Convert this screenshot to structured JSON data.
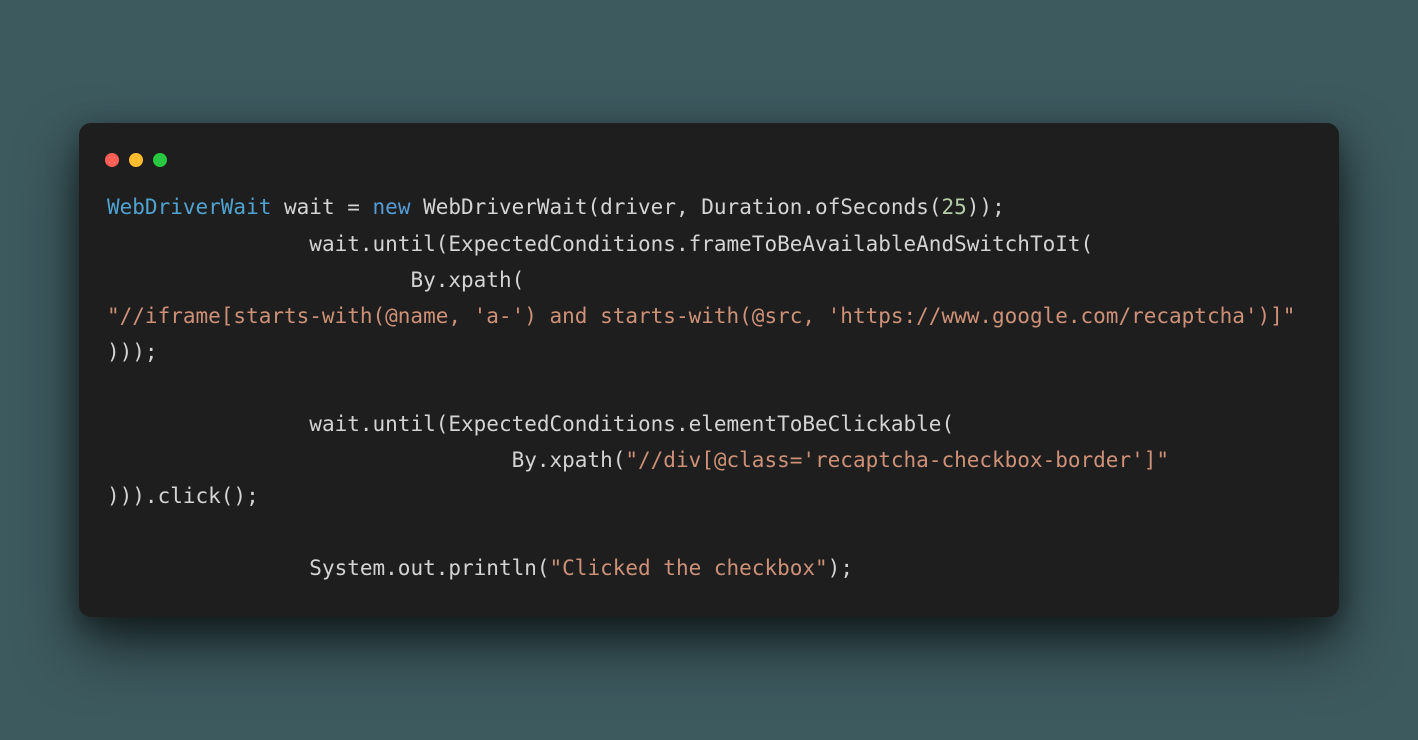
{
  "code": {
    "l1_type": "WebDriverWait",
    "l1_between": " wait = ",
    "l1_new": "new",
    "l1_rest": " WebDriverWait(driver, Duration.ofSeconds(",
    "l1_num": "25",
    "l1_close": "));",
    "l2_indent": "                ",
    "l2_rest": "wait.until(ExpectedConditions.frameToBeAvailableAndSwitchToIt(",
    "l3_indent": "                        ",
    "l3_rest": "By.xpath(",
    "l4_str": "\"//iframe[starts-with(@name, 'a-') and starts-with(@src, 'https://www.google.com/recaptcha')]\"",
    "l5_close": ")));",
    "blank": "",
    "l7_indent": "                ",
    "l7_rest": "wait.until(ExpectedConditions.elementToBeClickable(",
    "l8_indent": "                                ",
    "l8_call": "By.xpath(",
    "l8_str": "\"//div[@class='recaptcha-checkbox-border']\"",
    "l9_close": "))).click();",
    "l11_indent": "                ",
    "l11_call": "System.out.println(",
    "l11_str": "\"Clicked the checkbox\"",
    "l11_close": ");"
  }
}
